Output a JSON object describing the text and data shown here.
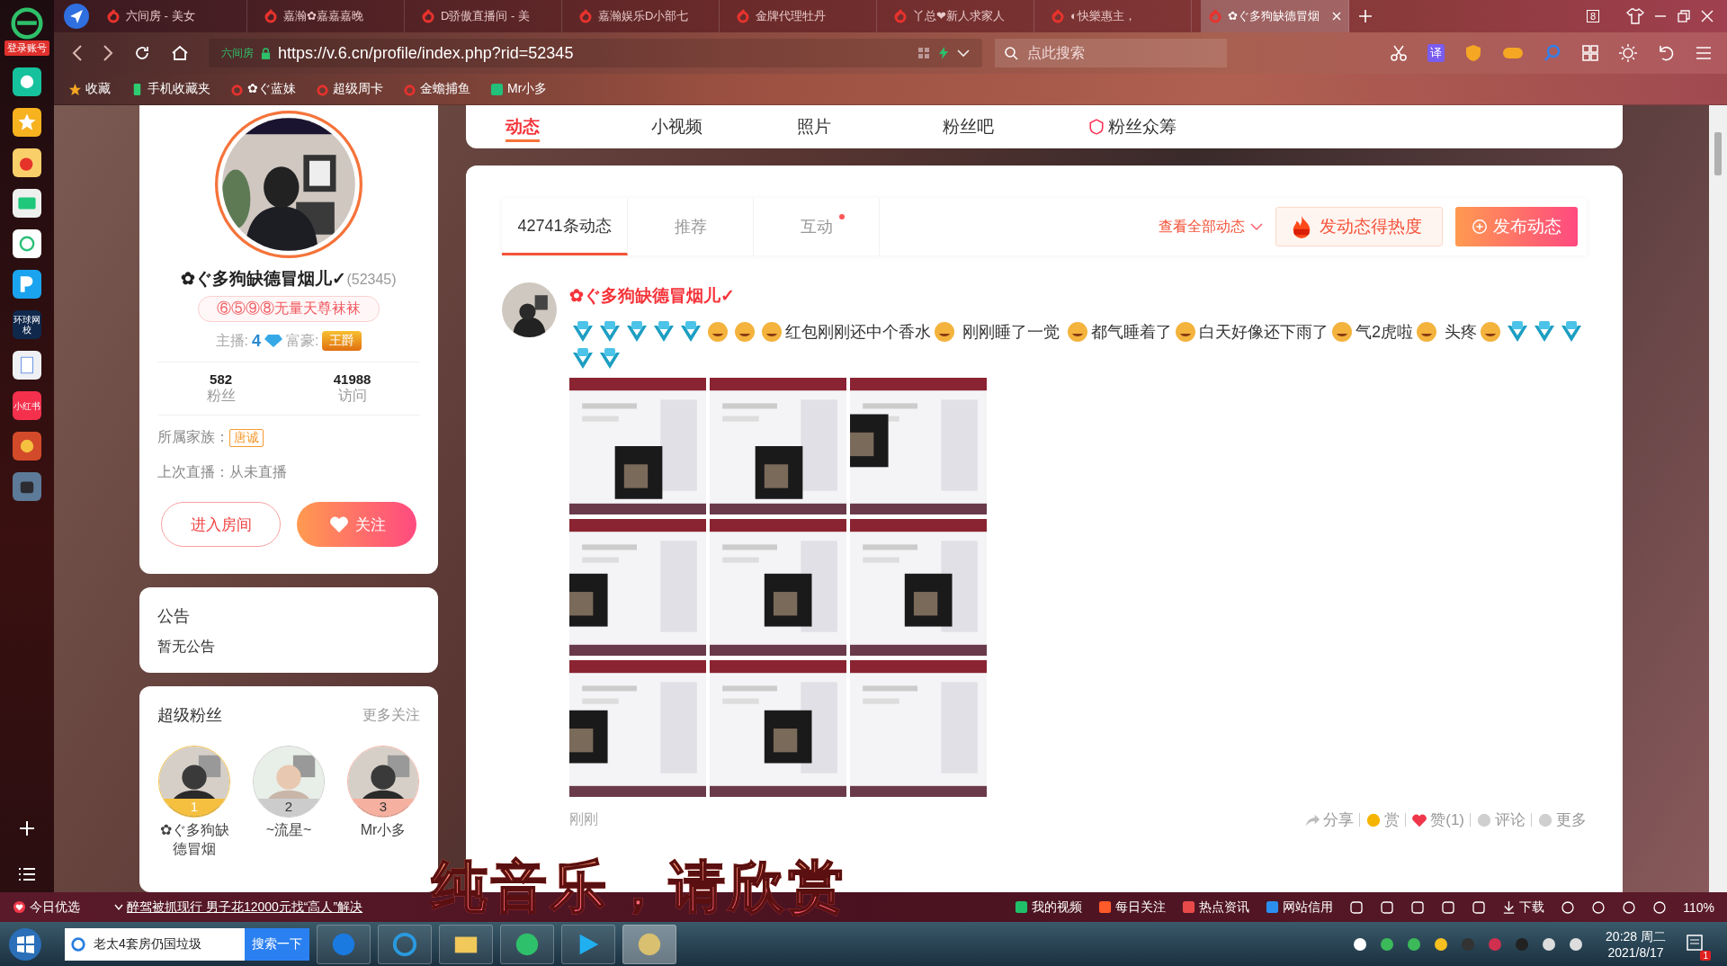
{
  "sidebar": {
    "login": "登录账号",
    "apps": [
      {
        "kind": "chat"
      },
      {
        "kind": "star"
      },
      {
        "kind": "weibo"
      },
      {
        "kind": "mail"
      },
      {
        "kind": "cloud"
      },
      {
        "kind": "pin"
      },
      {
        "kind": "school",
        "label": "环球网校"
      },
      {
        "kind": "doc"
      },
      {
        "kind": "redbook",
        "label": "小红书"
      },
      {
        "kind": "game"
      },
      {
        "kind": "game2"
      }
    ]
  },
  "browser": {
    "tabs": [
      {
        "title": "六间房 - 美女",
        "selected": false
      },
      {
        "title": "嘉瀚✿嘉嘉嘉晚",
        "selected": false
      },
      {
        "title": "D骄傲直播间 - 美",
        "selected": false
      },
      {
        "title": "嘉瀚娱乐D小部七",
        "selected": false
      },
      {
        "title": "金牌代理牡丹",
        "selected": false
      },
      {
        "title": "丫总❤新人求家人",
        "selected": false
      },
      {
        "title": "◐快樂惠主，",
        "selected": false
      },
      {
        "title": "✿ぐ多狗缺德冒烟",
        "selected": true
      }
    ],
    "tab_count": "8",
    "address": {
      "site": "六间房",
      "url": "https://v.6.cn/profile/index.php?rid=52345"
    },
    "search": {
      "placeholder": "点此搜索"
    },
    "translate": "译",
    "bookmarks": [
      {
        "label": "收藏",
        "kind": "star"
      },
      {
        "label": "手机收藏夹",
        "kind": "phone"
      },
      {
        "label": "✿ぐ蓝妹",
        "kind": "six"
      },
      {
        "label": "超级周卡",
        "kind": "six"
      },
      {
        "label": "金蟾捕鱼",
        "kind": "six"
      },
      {
        "label": "Mr小多",
        "kind": "app"
      }
    ]
  },
  "profile": {
    "name": "✿ぐ多狗缺德冒烟儿✓",
    "id": "(52345)",
    "title": "⑥⑤⑨⑧无量天尊袜袜",
    "anchor_label": "主播:",
    "anchor_level": "4",
    "rich_label": "富豪:",
    "rich_rank": "王爵",
    "stats": [
      {
        "value": "582",
        "label": "粉丝"
      },
      {
        "value": "41988",
        "label": "访问"
      }
    ],
    "family_label": "所属家族：",
    "family": "唐诚",
    "last_live": "上次直播：从未直播",
    "enter_button": "进入房间",
    "follow_button": "关注"
  },
  "notice": {
    "title": "公告",
    "text": "暂无公告"
  },
  "fans": {
    "title": "超级粉丝",
    "more": "更多关注",
    "items": [
      {
        "rank": "1",
        "name": "✿ぐ多狗缺德冒烟"
      },
      {
        "rank": "2",
        "name": "~流星~"
      },
      {
        "rank": "3",
        "name": "Mr小多"
      }
    ]
  },
  "nav": [
    {
      "label": "动态",
      "selected": true,
      "kind": "plain"
    },
    {
      "label": "小视频",
      "selected": false,
      "kind": "plain"
    },
    {
      "label": "照片",
      "selected": false,
      "kind": "plain"
    },
    {
      "label": "粉丝吧",
      "selected": false,
      "kind": "plain"
    },
    {
      "label": "粉丝众筹",
      "selected": false,
      "kind": "badge"
    }
  ],
  "feed": {
    "tabs": [
      {
        "label": "42741条动态",
        "selected": true,
        "dot": false
      },
      {
        "label": "推荐",
        "selected": false,
        "dot": false
      },
      {
        "label": "互动",
        "selected": false,
        "dot": true
      }
    ],
    "view_all": "查看全部动态",
    "hot_button": "发动态得热度",
    "post_button": "发布动态",
    "post": {
      "author": "✿ぐ多狗缺德冒烟儿✓",
      "segments": [
        {
          "kind": "level"
        },
        {
          "kind": "level"
        },
        {
          "kind": "level"
        },
        {
          "kind": "level"
        },
        {
          "kind": "level"
        },
        {
          "kind": "emoji"
        },
        {
          "kind": "emoji"
        },
        {
          "kind": "emoji"
        },
        {
          "kind": "text",
          "text": "红包刚刚还中个香水"
        },
        {
          "kind": "emoji"
        },
        {
          "kind": "text",
          "text": " 刚刚睡了一觉 "
        },
        {
          "kind": "emoji"
        },
        {
          "kind": "text",
          "text": "都气睡着了"
        },
        {
          "kind": "emoji"
        },
        {
          "kind": "text",
          "text": "白天好像还下雨了"
        },
        {
          "kind": "emoji"
        },
        {
          "kind": "text",
          "text": "气2虎啦"
        },
        {
          "kind": "emoji"
        },
        {
          "kind": "text",
          "text": " 头疼"
        },
        {
          "kind": "emoji"
        },
        {
          "kind": "level"
        },
        {
          "kind": "level"
        },
        {
          "kind": "level"
        },
        {
          "kind": "level"
        },
        {
          "kind": "level"
        }
      ],
      "time": "刚刚",
      "actions": [
        {
          "kind": "share",
          "label": "分享"
        },
        {
          "kind": "reward",
          "label": "赏"
        },
        {
          "kind": "like",
          "label": "赞(1)"
        },
        {
          "kind": "comment",
          "label": "评论"
        },
        {
          "kind": "more",
          "label": "更多"
        }
      ]
    }
  },
  "overlay": "纯音乐，请欣赏",
  "status_bar": {
    "pick": "今日优选",
    "news": "醉驾被抓现行 男子花12000元找“高人”解决",
    "links": [
      {
        "kind": "video",
        "label": "我的视频"
      },
      {
        "kind": "fire",
        "label": "每日关注"
      },
      {
        "kind": "news",
        "label": "热点资讯"
      },
      {
        "kind": "shield",
        "label": "网站信用"
      }
    ],
    "download": "下载",
    "zoom": "110%"
  },
  "taskbar": {
    "search_value": "老太4套房仍国垃圾",
    "search_button": "搜索一下",
    "time": "20:28 周二",
    "date": "2021/8/17",
    "notifications": "1"
  }
}
